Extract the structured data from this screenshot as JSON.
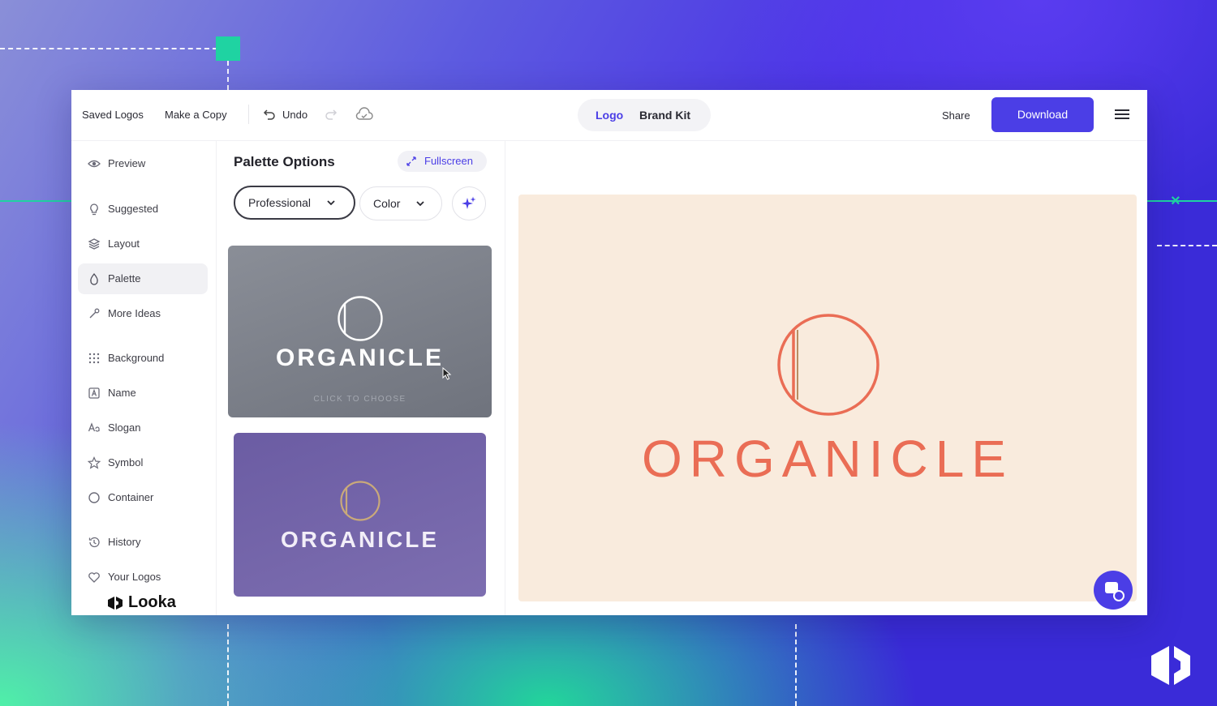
{
  "topbar": {
    "saved_logos": "Saved Logos",
    "make_copy": "Make a Copy",
    "undo": "Undo",
    "tab_logo": "Logo",
    "tab_brand_kit": "Brand Kit",
    "share": "Share",
    "download": "Download"
  },
  "sidebar": {
    "items": [
      {
        "label": "Preview",
        "icon": "eye-icon"
      },
      {
        "label": "Suggested",
        "icon": "bulb-icon"
      },
      {
        "label": "Layout",
        "icon": "layers-icon"
      },
      {
        "label": "Palette",
        "icon": "drop-icon"
      },
      {
        "label": "More Ideas",
        "icon": "magic-wand-icon"
      },
      {
        "label": "Background",
        "icon": "grid-dots-icon"
      },
      {
        "label": "Name",
        "icon": "text-box-icon"
      },
      {
        "label": "Slogan",
        "icon": "text-style-icon"
      },
      {
        "label": "Symbol",
        "icon": "star-icon"
      },
      {
        "label": "Container",
        "icon": "circle-icon"
      },
      {
        "label": "History",
        "icon": "history-icon"
      },
      {
        "label": "Your Logos",
        "icon": "heart-icon"
      }
    ],
    "active": "Palette",
    "brand": "Looka"
  },
  "panel": {
    "title": "Palette Options",
    "fullscreen": "Fullscreen",
    "style_select": "Professional",
    "color_select": "Color",
    "cards": [
      {
        "logo_text": "ORGANICLE",
        "hint": "CLICK TO CHOOSE",
        "bg": "#7c8089"
      },
      {
        "logo_text": "ORGANICLE",
        "hint": "",
        "bg": "#7a6ba8"
      }
    ]
  },
  "preview": {
    "logo_text": "ORGANICLE",
    "bg": "#f9ebdd",
    "accent": "#ea6d55"
  },
  "colors": {
    "primary": "#4b3ee6",
    "teal_accent": "#1fd3a2"
  }
}
